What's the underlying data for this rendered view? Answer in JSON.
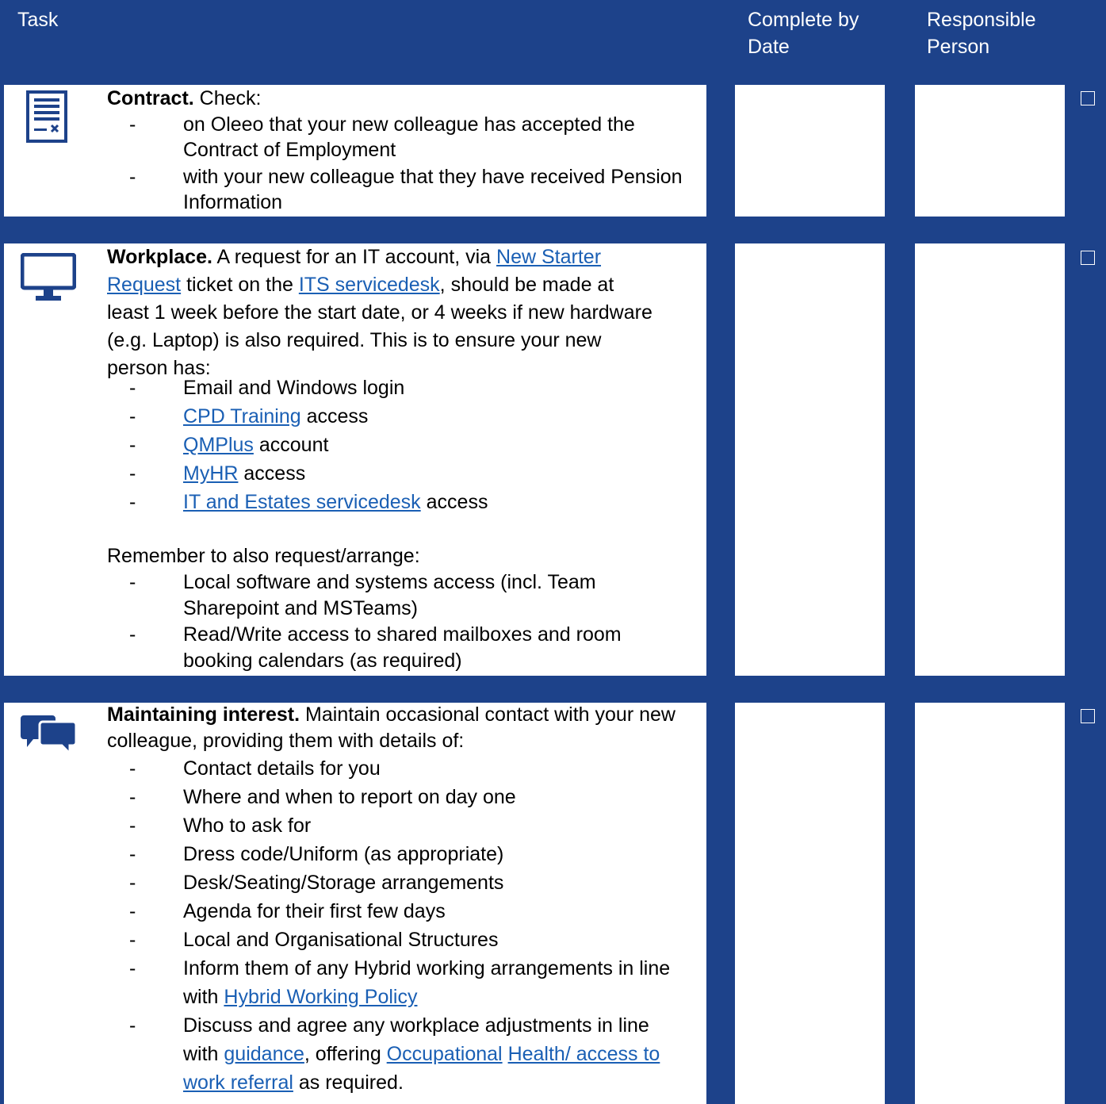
{
  "header": {
    "task": "Task",
    "complete_by": "Complete by\nDate",
    "responsible": "Responsible\nPerson"
  },
  "rows": [
    {
      "icon": "contract-icon",
      "title": "Contract.",
      "intro": " Check:",
      "bullets": [
        {
          "parts": [
            {
              "t": "on Oleeo that your new colleague has accepted the Contract of Employment"
            }
          ]
        },
        {
          "parts": [
            {
              "t": "with your new colleague that they have received Pension Information"
            }
          ]
        }
      ]
    },
    {
      "icon": "monitor-icon",
      "title": "Workplace.",
      "intro_parts": [
        {
          "t": " A request for an IT account, via "
        },
        {
          "t": "New Starter Request",
          "link": true
        },
        {
          "t": " ticket on the "
        },
        {
          "t": "ITS servicedesk",
          "link": true
        },
        {
          "t": ", should be made at least 1 week before the start date, or 4 weeks if new hardware (e.g. Laptop) is also required. This is to ensure your new person has:"
        }
      ],
      "bullets": [
        {
          "parts": [
            {
              "t": "Email and Windows login"
            }
          ]
        },
        {
          "parts": [
            {
              "t": "CPD Training",
              "link": true
            },
            {
              "t": " access"
            }
          ]
        },
        {
          "parts": [
            {
              "t": "QMPlus",
              "link": true
            },
            {
              "t": " account"
            }
          ]
        },
        {
          "parts": [
            {
              "t": "MyHR",
              "link": true
            },
            {
              "t": " access"
            }
          ]
        },
        {
          "parts": [
            {
              "t": "IT and Estates servicedesk",
              "link": true
            },
            {
              "t": " access"
            }
          ]
        }
      ],
      "remember": "Remember to also request/arrange:",
      "bullets2": [
        {
          "parts": [
            {
              "t": "Local software and systems access (incl. Team Sharepoint and MSTeams)"
            }
          ]
        },
        {
          "parts": [
            {
              "t": "Read/Write access to shared mailboxes and room booking calendars (as required)"
            }
          ]
        }
      ]
    },
    {
      "icon": "chat-bubbles-icon",
      "title": "Maintaining interest.",
      "intro": " Maintain occasional contact with your new colleague, providing them with details of:",
      "bullets": [
        {
          "parts": [
            {
              "t": "Contact details for you"
            }
          ]
        },
        {
          "parts": [
            {
              "t": "Where and when to report on day one"
            }
          ]
        },
        {
          "parts": [
            {
              "t": "Who to ask for"
            }
          ]
        },
        {
          "parts": [
            {
              "t": "Dress code/Uniform (as appropriate)"
            }
          ]
        },
        {
          "parts": [
            {
              "t": "Desk/Seating/Storage arrangements"
            }
          ]
        },
        {
          "parts": [
            {
              "t": "Agenda for their first few days"
            }
          ]
        },
        {
          "parts": [
            {
              "t": "Local and Organisational Structures"
            }
          ]
        },
        {
          "parts": [
            {
              "t": "Inform them of any Hybrid working arrangements in line with "
            },
            {
              "t": "Hybrid Working Policy",
              "link": true
            }
          ]
        },
        {
          "parts": [
            {
              "t": "Discuss and agree any workplace adjustments in line with "
            },
            {
              "t": "guidance",
              "link": true
            },
            {
              "t": ", offering "
            },
            {
              "t": "Occupational",
              "link": true
            },
            {
              "t": " "
            },
            {
              "t": "Health/ access to work referral",
              "link": true
            },
            {
              "t": " as required."
            }
          ]
        }
      ]
    }
  ],
  "checkbox_glyph": "☐",
  "colors": {
    "background": "#1d428a",
    "link": "#1a5fb4"
  }
}
